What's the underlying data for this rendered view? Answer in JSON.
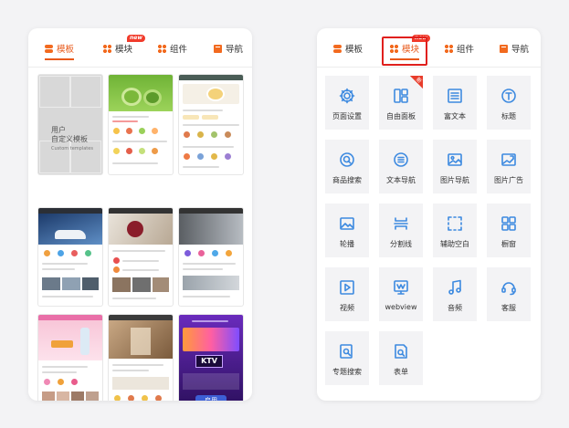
{
  "left_tabs": [
    {
      "label": "模板",
      "icon": "stack-icon",
      "active": true
    },
    {
      "label": "模块",
      "icon": "grid-icon",
      "badge": "new"
    },
    {
      "label": "组件",
      "icon": "grid-icon"
    },
    {
      "label": "导航",
      "icon": "book-icon"
    }
  ],
  "right_tabs": [
    {
      "label": "模板",
      "icon": "stack-icon"
    },
    {
      "label": "模块",
      "icon": "grid-icon",
      "active": true,
      "badge": "new"
    },
    {
      "label": "组件",
      "icon": "grid-icon"
    },
    {
      "label": "导航",
      "icon": "book-icon"
    }
  ],
  "custom_template": {
    "line1": "用户",
    "line2": "自定义模板",
    "line3": "Custom templates"
  },
  "templates": {
    "t_ktv": "KTV",
    "t_apply": "启用"
  },
  "modules": [
    {
      "label": "页面设置",
      "icon": "gear-icon"
    },
    {
      "label": "自由面板",
      "icon": "free-panel-icon",
      "corner": "新"
    },
    {
      "label": "富文本",
      "icon": "rich-text-icon"
    },
    {
      "label": "标题",
      "icon": "title-icon"
    },
    {
      "label": "商品搜索",
      "icon": "search-icon"
    },
    {
      "label": "文本导航",
      "icon": "list-icon"
    },
    {
      "label": "图片导航",
      "icon": "image-nav-icon"
    },
    {
      "label": "图片广告",
      "icon": "image-ad-icon"
    },
    {
      "label": "轮播",
      "icon": "carousel-icon"
    },
    {
      "label": "分割线",
      "icon": "divider-icon"
    },
    {
      "label": "辅助空白",
      "icon": "blank-icon"
    },
    {
      "label": "橱窗",
      "icon": "showcase-icon"
    },
    {
      "label": "视频",
      "icon": "video-icon"
    },
    {
      "label": "webview",
      "icon": "webview-icon"
    },
    {
      "label": "音频",
      "icon": "music-icon"
    },
    {
      "label": "客服",
      "icon": "headset-icon"
    },
    {
      "label": "专题搜索",
      "icon": "topic-search-icon"
    },
    {
      "label": "表单",
      "icon": "form-icon"
    }
  ],
  "colors": {
    "accent": "#e8591a",
    "icon_blue": "#3d8ae0",
    "highlight": "#e0201d"
  }
}
